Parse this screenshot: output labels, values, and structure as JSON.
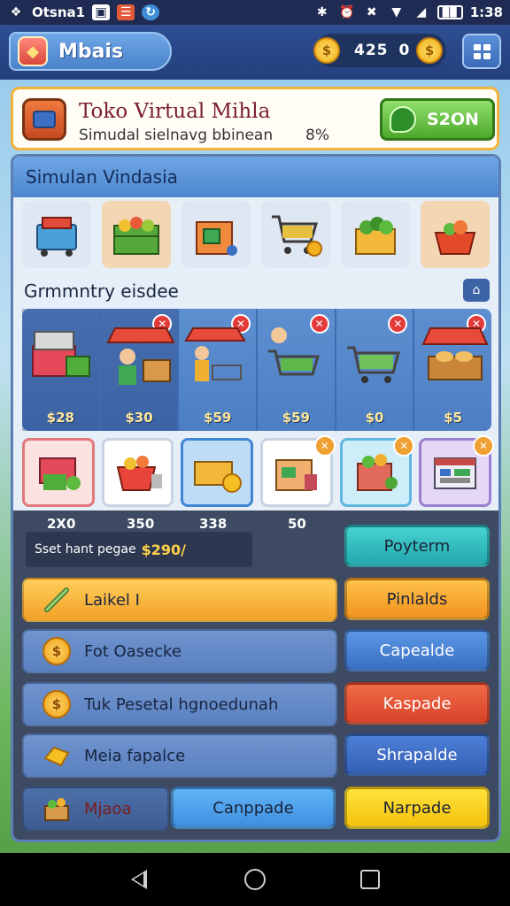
{
  "status_bar": {
    "left_text": "Otsna1",
    "time": "1:38",
    "icons": [
      "notification-icon",
      "app-icon",
      "sync-icon",
      "bluetooth-icon",
      "alarm-icon",
      "mute-icon",
      "wifi-icon",
      "signal-icon",
      "battery-icon"
    ]
  },
  "header": {
    "title": "Mbais",
    "currency_value": "425",
    "currency_secondary": "0",
    "coin_symbol": "$"
  },
  "banner": {
    "title": "Toko Virtual Mihla",
    "subtitle": "Simudal sielnavg bbinean",
    "percent": "8%",
    "button_label": "S2ON"
  },
  "panel": {
    "heading": "Simulan Vindasia",
    "section_title": "Grmmntry eisdee",
    "categories": [
      "cart-basket",
      "produce-stand",
      "small-shop",
      "shopping-cart",
      "vegetable-crate",
      "fruit-bowl"
    ],
    "stalls": [
      {
        "price": "$28",
        "badge": false
      },
      {
        "price": "$30",
        "badge": true
      },
      {
        "price": "$59",
        "badge": true
      },
      {
        "price": "$59",
        "badge": true
      },
      {
        "price": "$0",
        "badge": true
      },
      {
        "price": "$5",
        "badge": true
      }
    ],
    "items": [
      {
        "theme": "red",
        "badge": false
      },
      {
        "theme": "white",
        "badge": false
      },
      {
        "theme": "blue",
        "badge": false
      },
      {
        "theme": "white",
        "badge": true
      },
      {
        "theme": "teal",
        "badge": true
      },
      {
        "theme": "purple",
        "badge": true
      }
    ],
    "stat_labels": [
      "2X0",
      "350",
      "338",
      "50"
    ],
    "promo_label": "Sset hant pegae",
    "promo_amount": "$290/",
    "actions": {
      "poyterm": "Poyterm",
      "pinlalds": "Pinlalds",
      "capealde": "Capealde",
      "kaspade": "Kaspade",
      "shrapalde": "Shrapalde",
      "narpade": "Narpade",
      "canppade": "Canppade"
    },
    "rows": [
      {
        "label": "Laikel I",
        "icon": "pencil-icon"
      },
      {
        "label": "Fot Oasecke",
        "icon": "coin-icon"
      },
      {
        "label": "Tuk Pesetal hgnoedunah",
        "icon": "coin-icon"
      },
      {
        "label": "Meia fapalce",
        "icon": "gold-bar-icon"
      },
      {
        "label": "Mjaoa",
        "icon": "crate-icon"
      }
    ]
  },
  "colors": {
    "primary": "#2d4f93",
    "accent_gold": "#f2b33a",
    "green": "#4ea82c",
    "orange": "#f3a128",
    "blue": "#3f74c8",
    "red": "#e0472e",
    "teal": "#2fbcc0",
    "yellow": "#f8d21e"
  }
}
